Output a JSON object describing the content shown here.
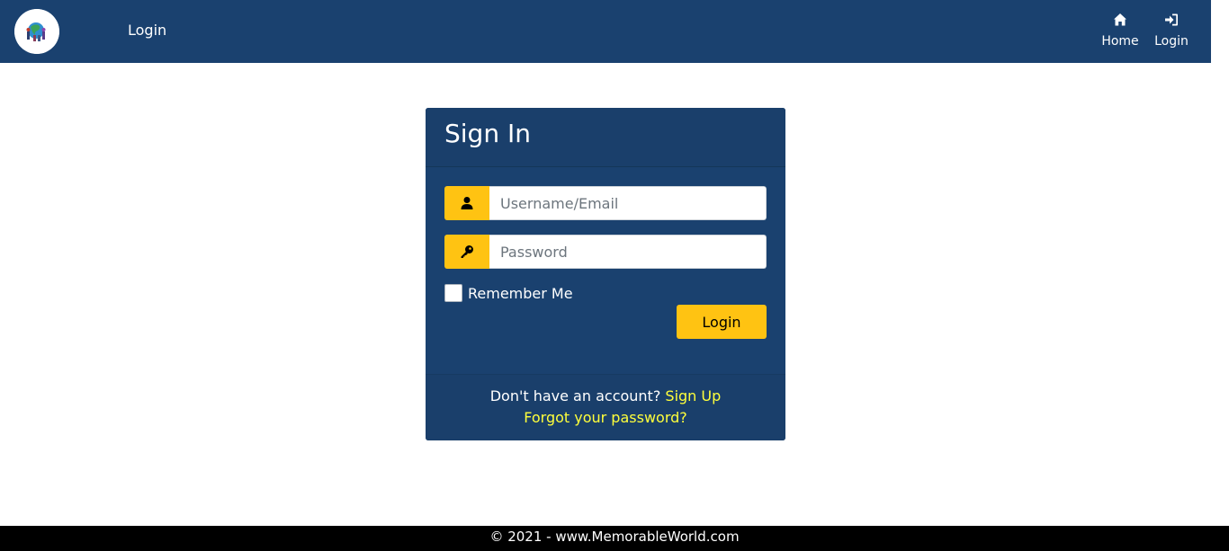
{
  "header": {
    "brand_label": "Login",
    "nav": [
      {
        "label": "Home",
        "icon": "home-icon"
      },
      {
        "label": "Login",
        "icon": "sign-in-icon"
      }
    ]
  },
  "card": {
    "title": "Sign In",
    "username": {
      "placeholder": "Username/Email",
      "value": "",
      "icon": "user-icon"
    },
    "password": {
      "placeholder": "Password",
      "value": "",
      "icon": "key-icon"
    },
    "remember_label": "Remember Me",
    "login_button": "Login",
    "no_account_text": "Don't have an account?",
    "signup_link": "Sign Up",
    "forgot_link": "Forgot your password?"
  },
  "footer": {
    "text": "© 2021 - www.MemorableWorld.com"
  },
  "colors": {
    "primary": "#1a416f",
    "accent": "#ffc312",
    "link": "#ffff3b",
    "footer_bg": "#000000"
  }
}
